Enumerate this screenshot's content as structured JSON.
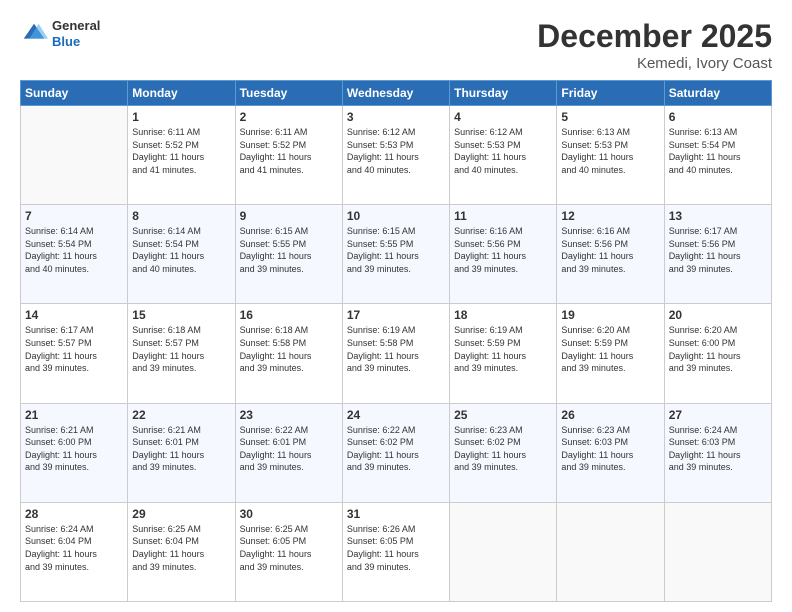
{
  "header": {
    "title": "December 2025",
    "subtitle": "Kemedi, Ivory Coast",
    "logo_general": "General",
    "logo_blue": "Blue"
  },
  "weekdays": [
    "Sunday",
    "Monday",
    "Tuesday",
    "Wednesday",
    "Thursday",
    "Friday",
    "Saturday"
  ],
  "weeks": [
    [
      {
        "day": "",
        "info": ""
      },
      {
        "day": "1",
        "info": "Sunrise: 6:11 AM\nSunset: 5:52 PM\nDaylight: 11 hours\nand 41 minutes."
      },
      {
        "day": "2",
        "info": "Sunrise: 6:11 AM\nSunset: 5:52 PM\nDaylight: 11 hours\nand 41 minutes."
      },
      {
        "day": "3",
        "info": "Sunrise: 6:12 AM\nSunset: 5:53 PM\nDaylight: 11 hours\nand 40 minutes."
      },
      {
        "day": "4",
        "info": "Sunrise: 6:12 AM\nSunset: 5:53 PM\nDaylight: 11 hours\nand 40 minutes."
      },
      {
        "day": "5",
        "info": "Sunrise: 6:13 AM\nSunset: 5:53 PM\nDaylight: 11 hours\nand 40 minutes."
      },
      {
        "day": "6",
        "info": "Sunrise: 6:13 AM\nSunset: 5:54 PM\nDaylight: 11 hours\nand 40 minutes."
      }
    ],
    [
      {
        "day": "7",
        "info": "Sunrise: 6:14 AM\nSunset: 5:54 PM\nDaylight: 11 hours\nand 40 minutes."
      },
      {
        "day": "8",
        "info": "Sunrise: 6:14 AM\nSunset: 5:54 PM\nDaylight: 11 hours\nand 40 minutes."
      },
      {
        "day": "9",
        "info": "Sunrise: 6:15 AM\nSunset: 5:55 PM\nDaylight: 11 hours\nand 39 minutes."
      },
      {
        "day": "10",
        "info": "Sunrise: 6:15 AM\nSunset: 5:55 PM\nDaylight: 11 hours\nand 39 minutes."
      },
      {
        "day": "11",
        "info": "Sunrise: 6:16 AM\nSunset: 5:56 PM\nDaylight: 11 hours\nand 39 minutes."
      },
      {
        "day": "12",
        "info": "Sunrise: 6:16 AM\nSunset: 5:56 PM\nDaylight: 11 hours\nand 39 minutes."
      },
      {
        "day": "13",
        "info": "Sunrise: 6:17 AM\nSunset: 5:56 PM\nDaylight: 11 hours\nand 39 minutes."
      }
    ],
    [
      {
        "day": "14",
        "info": "Sunrise: 6:17 AM\nSunset: 5:57 PM\nDaylight: 11 hours\nand 39 minutes."
      },
      {
        "day": "15",
        "info": "Sunrise: 6:18 AM\nSunset: 5:57 PM\nDaylight: 11 hours\nand 39 minutes."
      },
      {
        "day": "16",
        "info": "Sunrise: 6:18 AM\nSunset: 5:58 PM\nDaylight: 11 hours\nand 39 minutes."
      },
      {
        "day": "17",
        "info": "Sunrise: 6:19 AM\nSunset: 5:58 PM\nDaylight: 11 hours\nand 39 minutes."
      },
      {
        "day": "18",
        "info": "Sunrise: 6:19 AM\nSunset: 5:59 PM\nDaylight: 11 hours\nand 39 minutes."
      },
      {
        "day": "19",
        "info": "Sunrise: 6:20 AM\nSunset: 5:59 PM\nDaylight: 11 hours\nand 39 minutes."
      },
      {
        "day": "20",
        "info": "Sunrise: 6:20 AM\nSunset: 6:00 PM\nDaylight: 11 hours\nand 39 minutes."
      }
    ],
    [
      {
        "day": "21",
        "info": "Sunrise: 6:21 AM\nSunset: 6:00 PM\nDaylight: 11 hours\nand 39 minutes."
      },
      {
        "day": "22",
        "info": "Sunrise: 6:21 AM\nSunset: 6:01 PM\nDaylight: 11 hours\nand 39 minutes."
      },
      {
        "day": "23",
        "info": "Sunrise: 6:22 AM\nSunset: 6:01 PM\nDaylight: 11 hours\nand 39 minutes."
      },
      {
        "day": "24",
        "info": "Sunrise: 6:22 AM\nSunset: 6:02 PM\nDaylight: 11 hours\nand 39 minutes."
      },
      {
        "day": "25",
        "info": "Sunrise: 6:23 AM\nSunset: 6:02 PM\nDaylight: 11 hours\nand 39 minutes."
      },
      {
        "day": "26",
        "info": "Sunrise: 6:23 AM\nSunset: 6:03 PM\nDaylight: 11 hours\nand 39 minutes."
      },
      {
        "day": "27",
        "info": "Sunrise: 6:24 AM\nSunset: 6:03 PM\nDaylight: 11 hours\nand 39 minutes."
      }
    ],
    [
      {
        "day": "28",
        "info": "Sunrise: 6:24 AM\nSunset: 6:04 PM\nDaylight: 11 hours\nand 39 minutes."
      },
      {
        "day": "29",
        "info": "Sunrise: 6:25 AM\nSunset: 6:04 PM\nDaylight: 11 hours\nand 39 minutes."
      },
      {
        "day": "30",
        "info": "Sunrise: 6:25 AM\nSunset: 6:05 PM\nDaylight: 11 hours\nand 39 minutes."
      },
      {
        "day": "31",
        "info": "Sunrise: 6:26 AM\nSunset: 6:05 PM\nDaylight: 11 hours\nand 39 minutes."
      },
      {
        "day": "",
        "info": ""
      },
      {
        "day": "",
        "info": ""
      },
      {
        "day": "",
        "info": ""
      }
    ]
  ]
}
